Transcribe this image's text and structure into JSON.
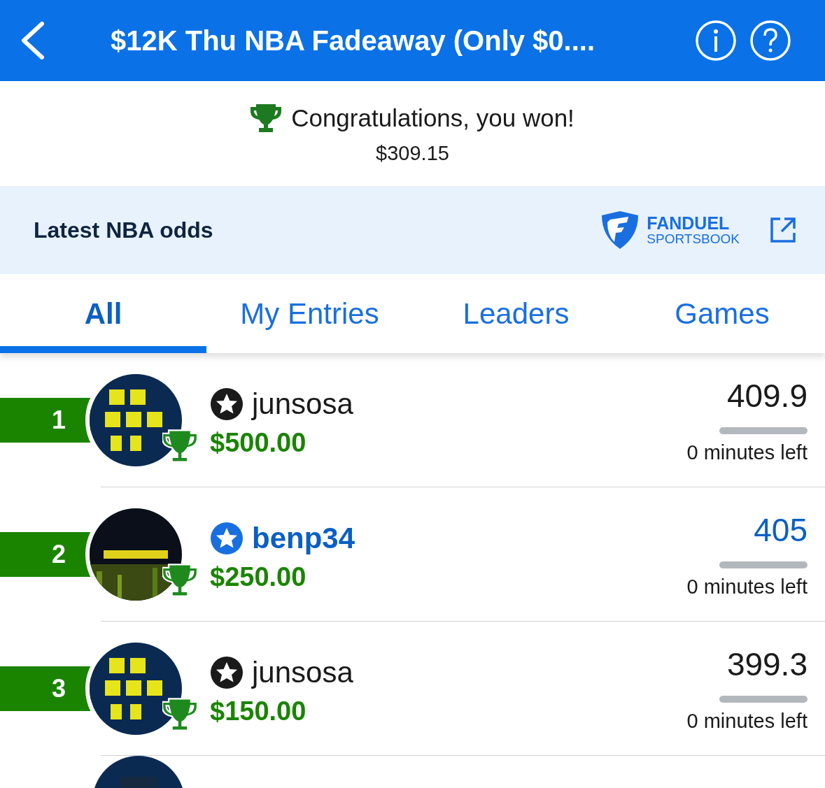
{
  "header": {
    "title": "$12K Thu NBA Fadeaway (Only $0...."
  },
  "result": {
    "message": "Congratulations, you won!",
    "amount": "$309.15"
  },
  "odds_banner": {
    "title": "Latest NBA odds",
    "brand": "FANDUEL",
    "brand_sub": "SPORTSBOOK"
  },
  "tabs": [
    {
      "label": "All",
      "selected": true
    },
    {
      "label": "My Entries",
      "selected": false
    },
    {
      "label": "Leaders",
      "selected": false
    },
    {
      "label": "Games",
      "selected": false
    }
  ],
  "entries": [
    {
      "rank": "1",
      "name": "junsosa",
      "prize": "$500.00",
      "score": "409.9",
      "level": 0,
      "time_left": "0 minutes left",
      "highlighted": false
    },
    {
      "rank": "2",
      "name": "benp34",
      "prize": "$250.00",
      "score": "405",
      "level": 0,
      "time_left": "0 minutes left",
      "highlighted": true
    },
    {
      "rank": "3",
      "name": "junsosa",
      "prize": "$150.00",
      "score": "399.3",
      "level": 0,
      "time_left": "0 minutes left",
      "highlighted": false
    }
  ]
}
